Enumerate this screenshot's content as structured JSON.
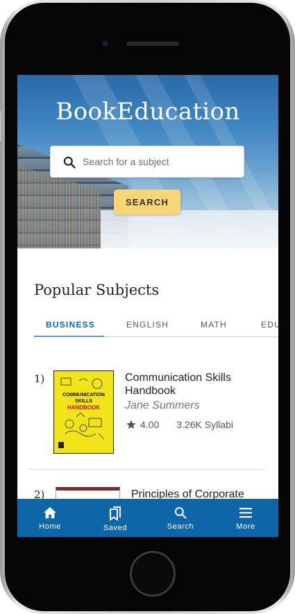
{
  "app": {
    "title": "BookEducation"
  },
  "search": {
    "placeholder": "Search for a subject",
    "value": "",
    "button_label": "SEARCH"
  },
  "popular": {
    "heading": "Popular Subjects",
    "tabs": [
      {
        "label": "BUSINESS",
        "active": true
      },
      {
        "label": "ENGLISH",
        "active": false
      },
      {
        "label": "MATH",
        "active": false
      },
      {
        "label": "EDU",
        "active": false
      }
    ]
  },
  "books": [
    {
      "rank": "1)",
      "title_line1": "Communication Skills",
      "title_line2": "Handbook",
      "author": "Jane Summers",
      "rating": "4.00",
      "syllabi": "3.26K Syllabi",
      "cover_text": {
        "line1": "COMMUNICATION",
        "line2": "SKILLS",
        "line3": "HANDBOOK"
      }
    },
    {
      "rank": "2)",
      "title_line1": "Principles of Corporate"
    }
  ],
  "nav": {
    "items": [
      {
        "label": "Home",
        "icon": "home-icon"
      },
      {
        "label": "Saved",
        "icon": "bookmarks-icon"
      },
      {
        "label": "Search",
        "icon": "search-icon"
      },
      {
        "label": "More",
        "icon": "menu-icon"
      }
    ]
  },
  "colors": {
    "primary": "#0d66a8",
    "accent": "#f8d678",
    "cover_yellow": "#f1e51a"
  }
}
